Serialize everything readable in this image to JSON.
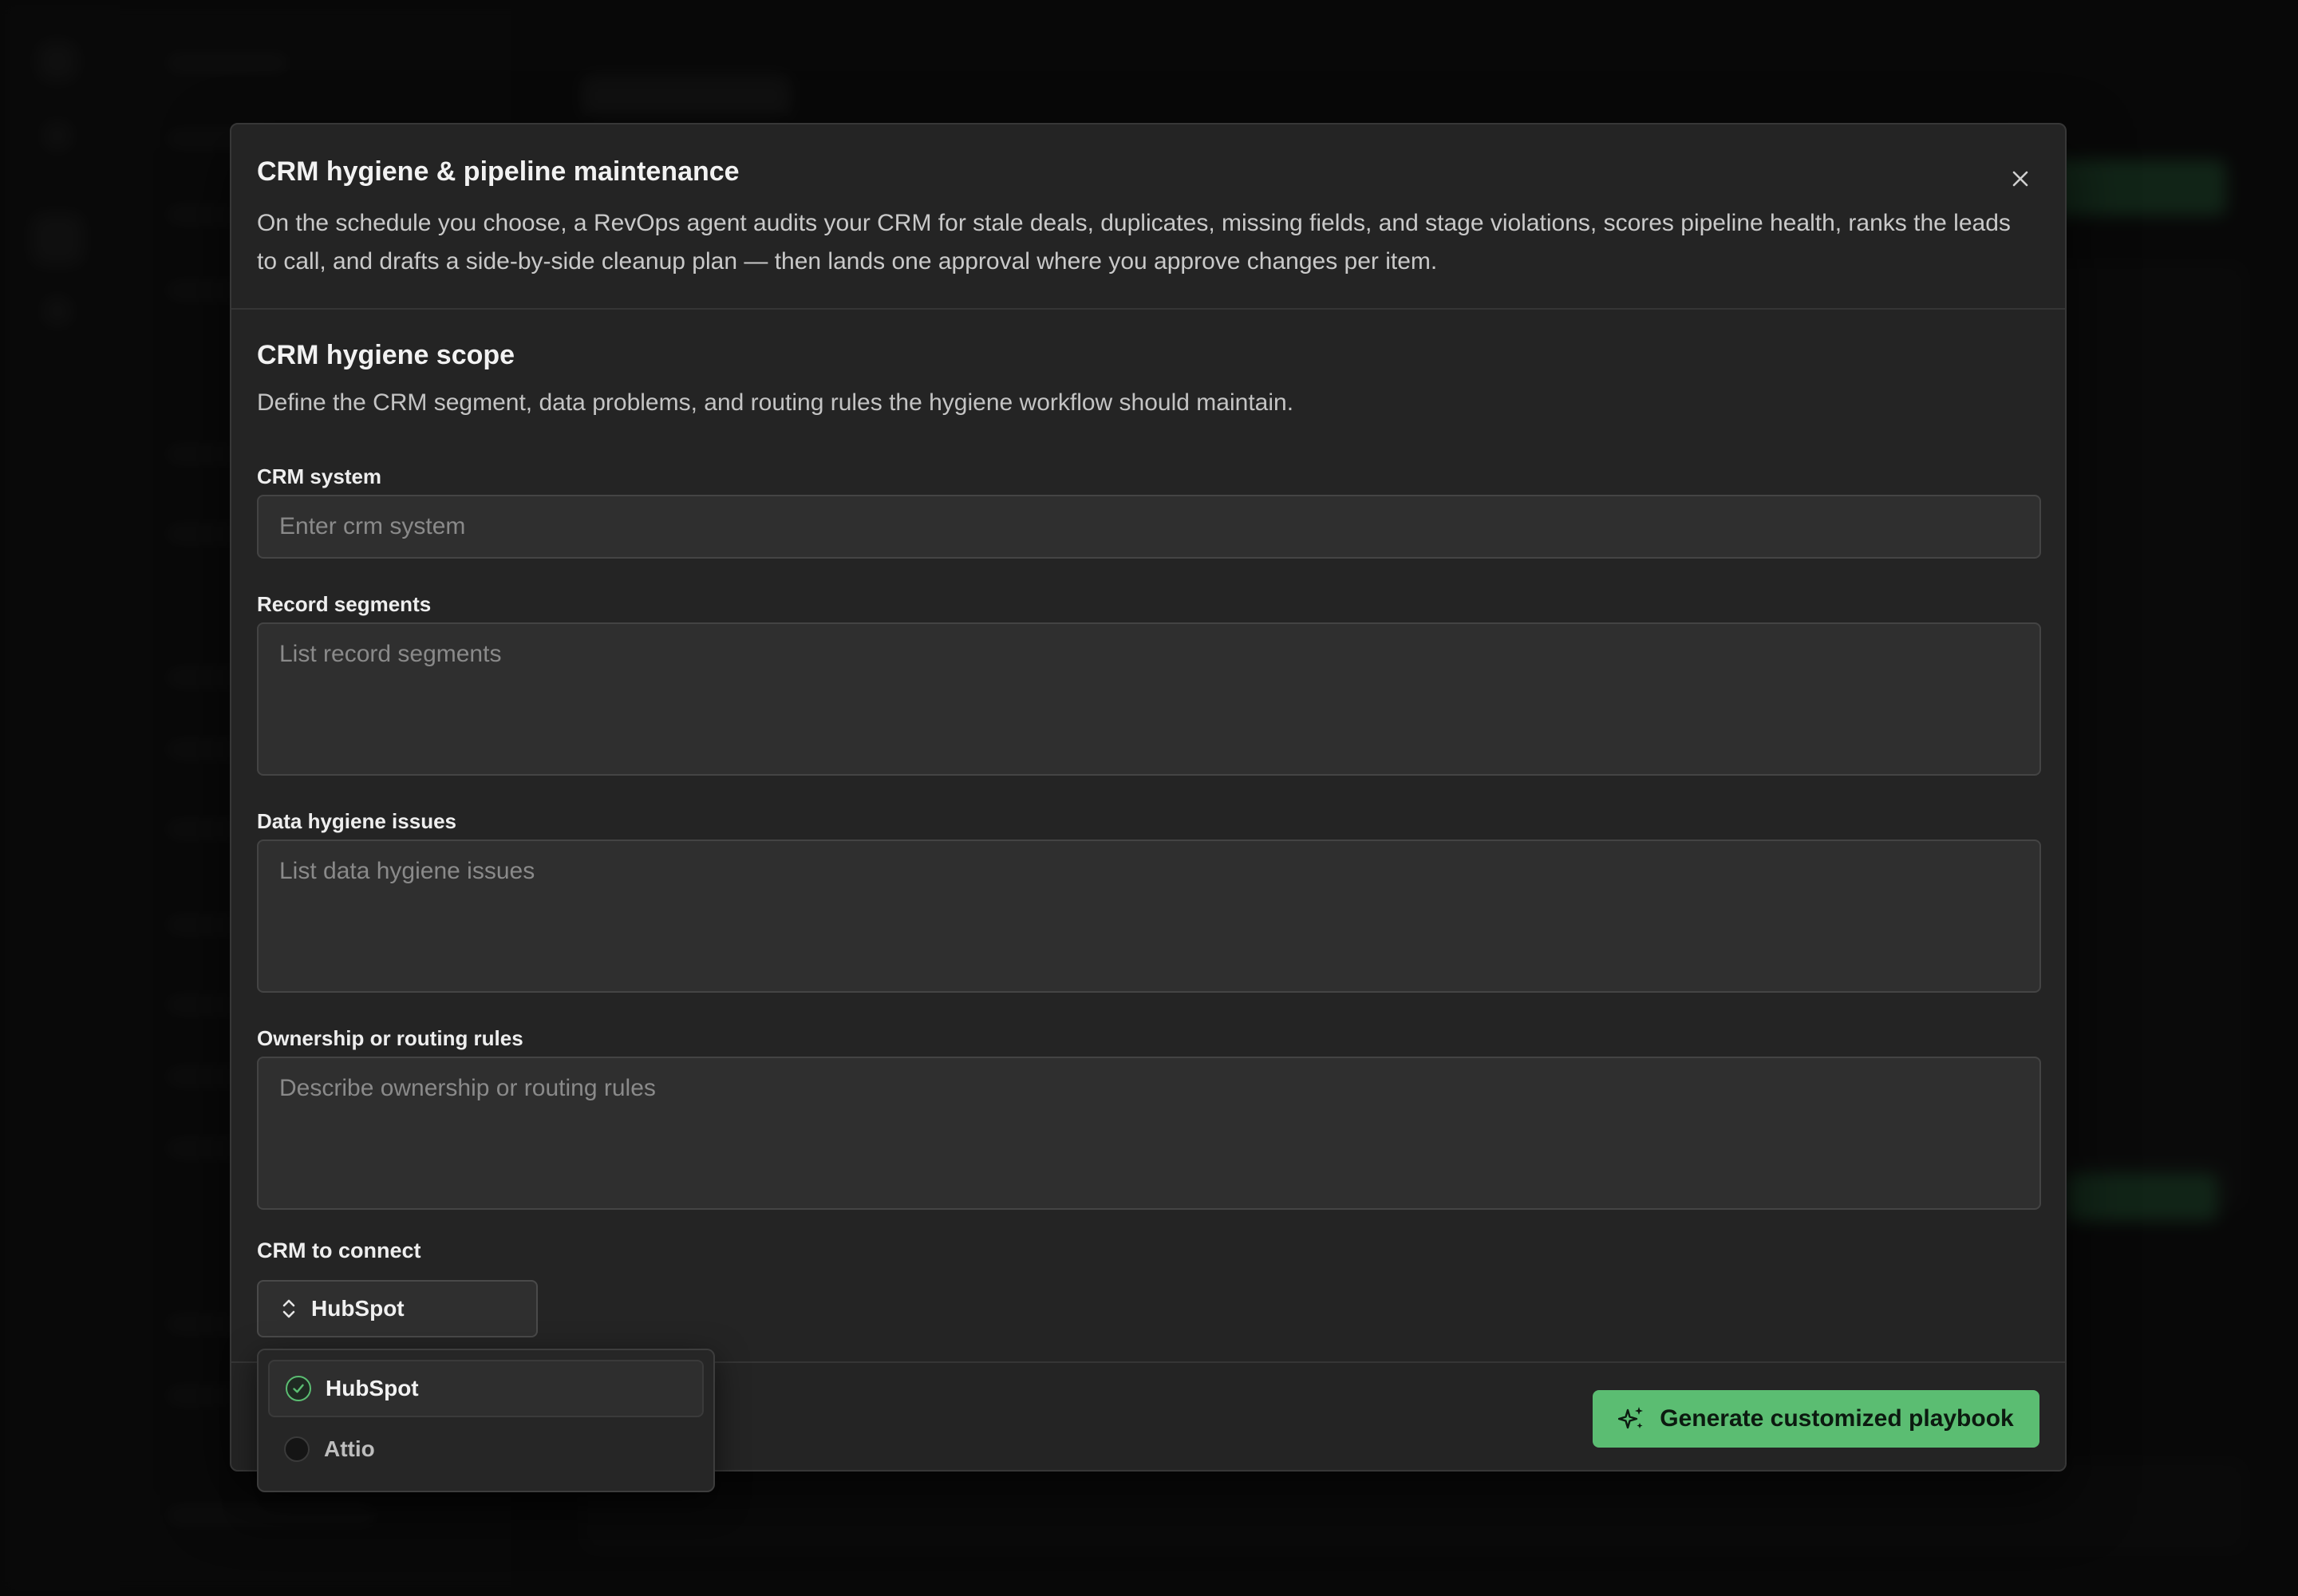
{
  "dialog": {
    "title": "CRM hygiene & pipeline maintenance",
    "description": "On the schedule you choose, a RevOps agent audits your CRM for stale deals, duplicates, missing fields, and stage violations, scores pipeline health, ranks the leads to call, and drafts a side-by-side cleanup plan — then lands one approval where you approve changes per item."
  },
  "section": {
    "title": "CRM hygiene scope",
    "description": "Define the CRM segment, data problems, and routing rules the hygiene workflow should maintain."
  },
  "fields": {
    "crm_system": {
      "label": "CRM system",
      "value": "",
      "placeholder": "Enter crm system"
    },
    "record_segments": {
      "label": "Record segments",
      "value": "",
      "placeholder": "List record segments"
    },
    "data_hygiene_issues": {
      "label": "Data hygiene issues",
      "value": "",
      "placeholder": "List data hygiene issues"
    },
    "routing_rules": {
      "label": "Ownership or routing rules",
      "value": "",
      "placeholder": "Describe ownership or routing rules"
    }
  },
  "crm_connect": {
    "label": "CRM to connect",
    "selected": "HubSpot",
    "options": [
      {
        "label": "HubSpot",
        "checked": true
      },
      {
        "label": "Attio",
        "checked": false
      }
    ]
  },
  "actions": {
    "generate": "Generate customized playbook"
  },
  "colors": {
    "accent": "#5bbd72",
    "modal_bg": "#242424",
    "input_bg": "#2f2f2f"
  },
  "icons": {
    "close": "close-icon",
    "select": "chevron-up-down-icon",
    "check": "check-icon",
    "generate": "sparkles-icon"
  }
}
